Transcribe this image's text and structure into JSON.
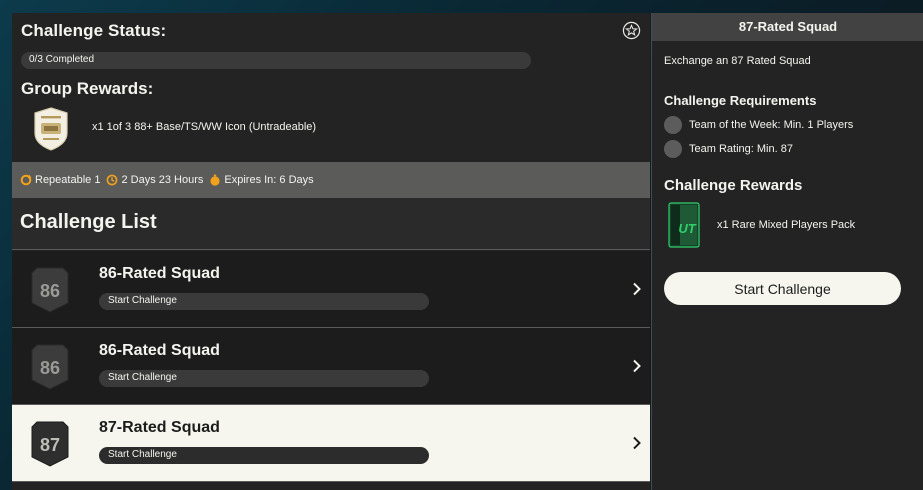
{
  "status": {
    "title": "Challenge Status:",
    "progress_text": "0/3 Completed",
    "progress_fraction": 0.0,
    "favorite_icon": "star-icon"
  },
  "group_rewards": {
    "title": "Group Rewards:",
    "reward_text": "x1 1of 3 88+ Base/TS/WW Icon (Untradeable)",
    "badge_icon": "player-pick-badge"
  },
  "meta": {
    "repeatable": "Repeatable 1",
    "refresh": "2 Days 23 Hours",
    "expires": "Expires In: 6 Days"
  },
  "challenge_list": {
    "title": "Challenge List",
    "items": [
      {
        "rating": "86",
        "name": "86-Rated Squad",
        "action": "Start Challenge",
        "selected": false
      },
      {
        "rating": "86",
        "name": "86-Rated Squad",
        "action": "Start Challenge",
        "selected": false
      },
      {
        "rating": "87",
        "name": "87-Rated Squad",
        "action": "Start Challenge",
        "selected": true
      }
    ]
  },
  "detail": {
    "header": "87-Rated Squad",
    "description": "Exchange an 87 Rated Squad",
    "requirements_title": "Challenge Requirements",
    "requirements": [
      "Team of the Week: Min. 1 Players",
      "Team Rating: Min. 87"
    ],
    "rewards_title": "Challenge Rewards",
    "reward_text": "x1 Rare Mixed Players Pack",
    "pack_label": "UT",
    "start_button": "Start Challenge"
  },
  "colors": {
    "panel": "#232323",
    "meta_bar": "#5b5b59",
    "selected_row": "#f6f6ef",
    "accent_orange": "#f0a21c",
    "pack_green": "#2fd06a"
  }
}
